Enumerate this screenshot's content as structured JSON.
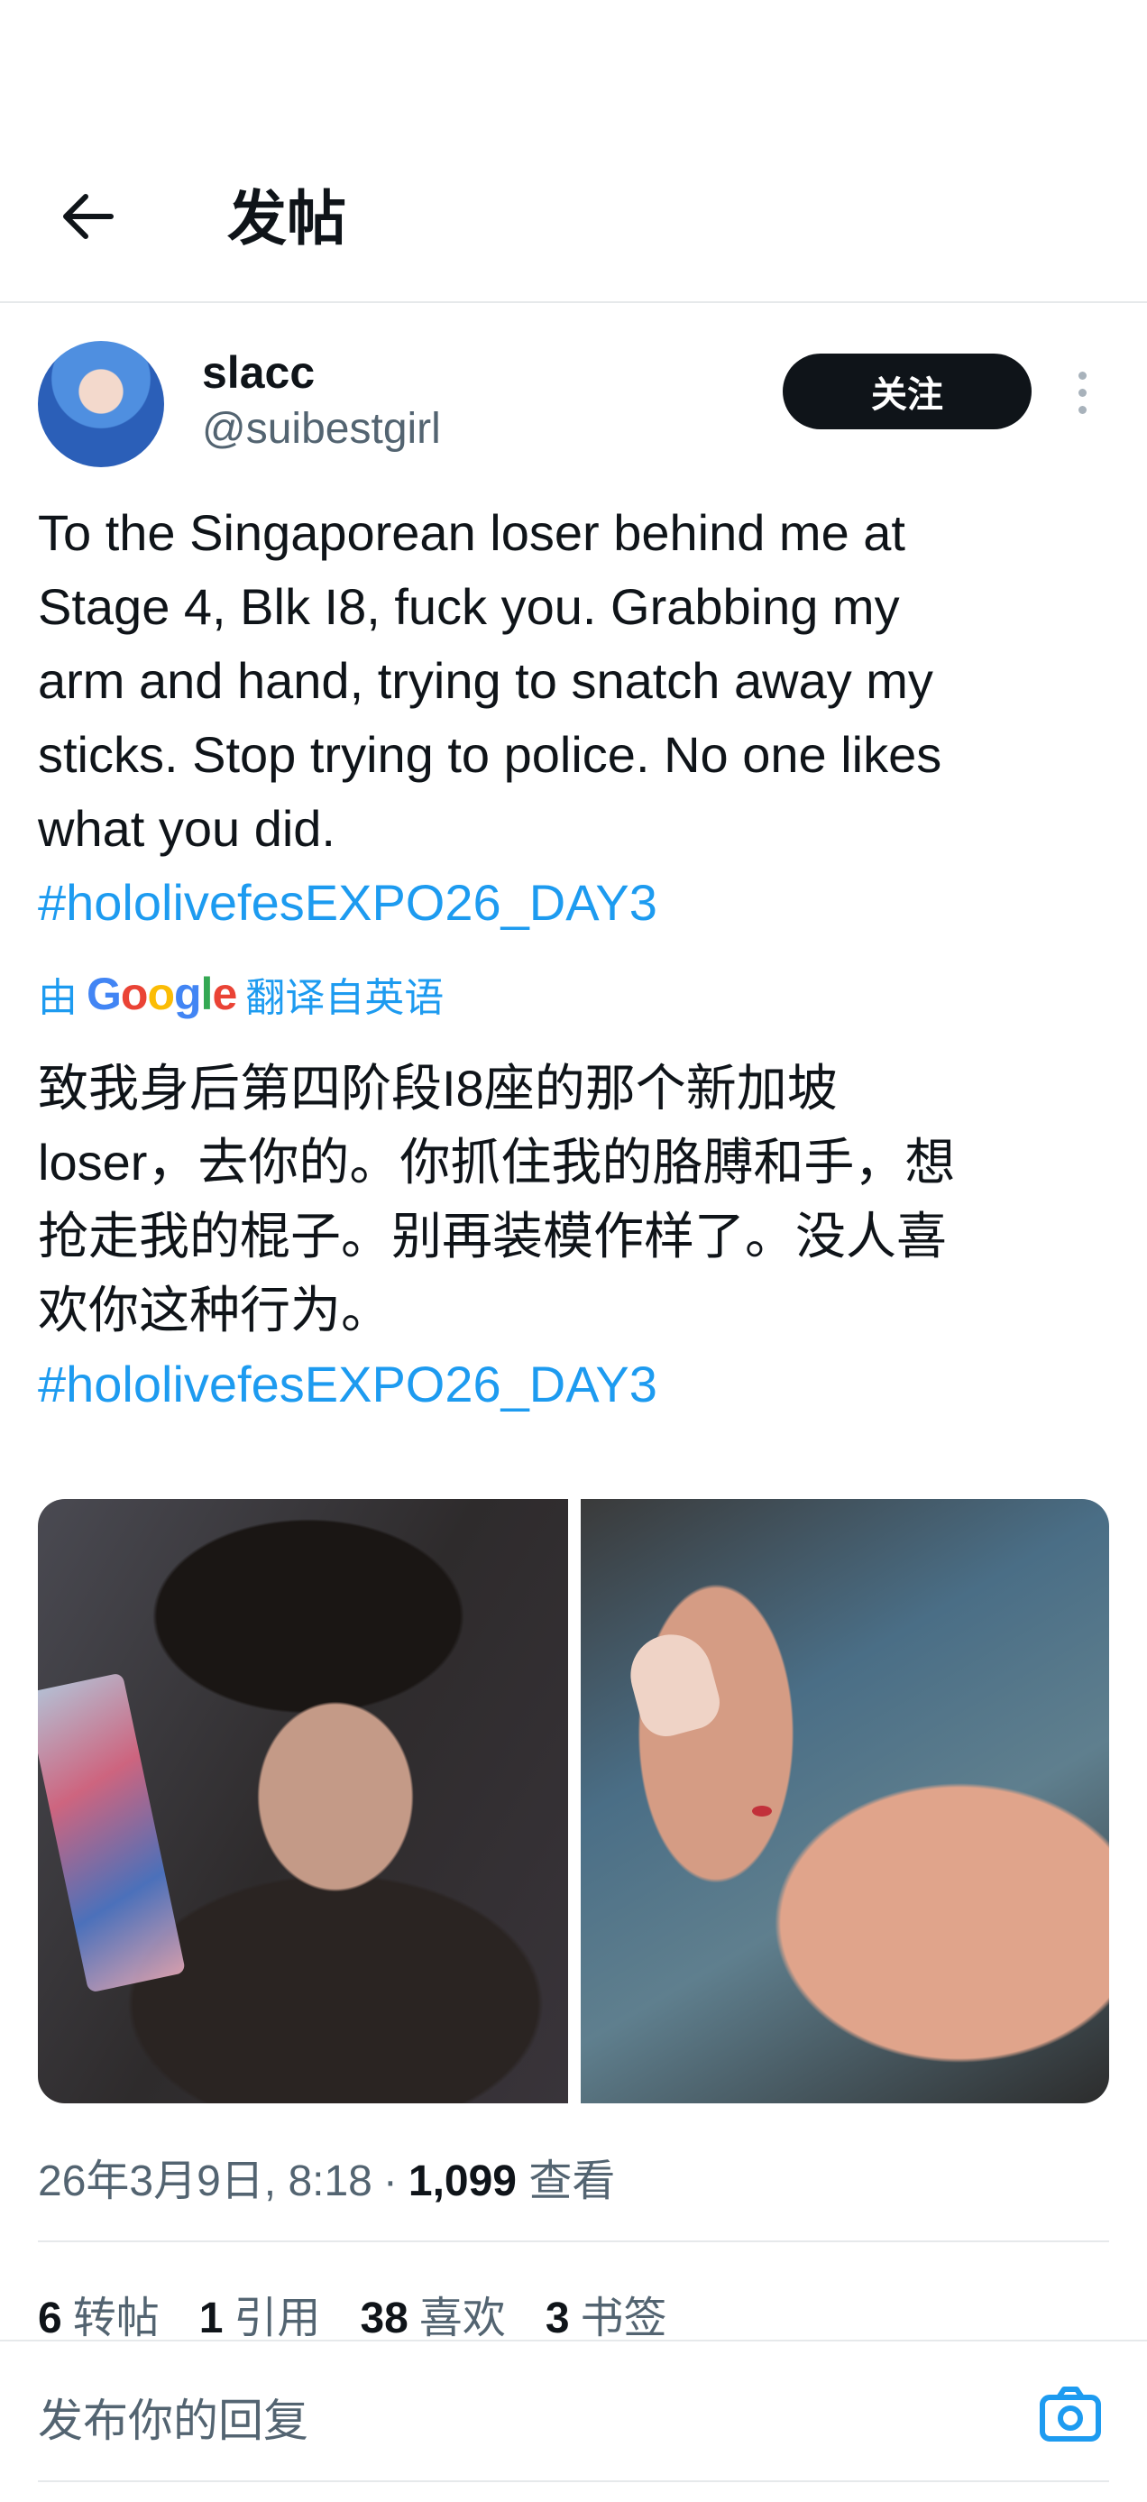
{
  "header": {
    "title": "发帖"
  },
  "author": {
    "name": "slacc",
    "handle": "@suibestgirl",
    "follow_label": "关注"
  },
  "tweet": {
    "text": "To the Singaporean loser behind me at\nStage 4, Blk I8, fuck you. Grabbing my\narm and hand, trying to snatch away my\nsticks. Stop trying to police. No one likes\nwhat you did.",
    "hashtag": "#hololivefesEXPO26_DAY3"
  },
  "translation": {
    "prefix": "由",
    "provider": "Google",
    "suffix": "翻译自英语",
    "text": "致我身后第四阶段I8座的那个新加坡\nloser，去你的。你抓住我的胳膊和手，想\n抢走我的棍子。别再装模作样了。没人喜\n欢你这种行为。",
    "hashtag": "#hololivefesEXPO26_DAY3"
  },
  "meta": {
    "datetime": "26年3月9日, 8:18",
    "separator": "·",
    "views_count": "1,099",
    "views_label": "查看"
  },
  "stats": [
    {
      "count": "6",
      "label": "转帖"
    },
    {
      "count": "1",
      "label": "引用"
    },
    {
      "count": "38",
      "label": "喜欢"
    },
    {
      "count": "3",
      "label": "书签"
    }
  ],
  "reply": {
    "placeholder": "发布你的回复"
  },
  "icons": {
    "back": "arrow-left-icon",
    "more": "more-vertical-icon",
    "camera": "camera-icon"
  },
  "colors": {
    "accent": "#1d9bf0",
    "text": "#0f1419",
    "muted": "#536471",
    "button": "#0f1419"
  }
}
